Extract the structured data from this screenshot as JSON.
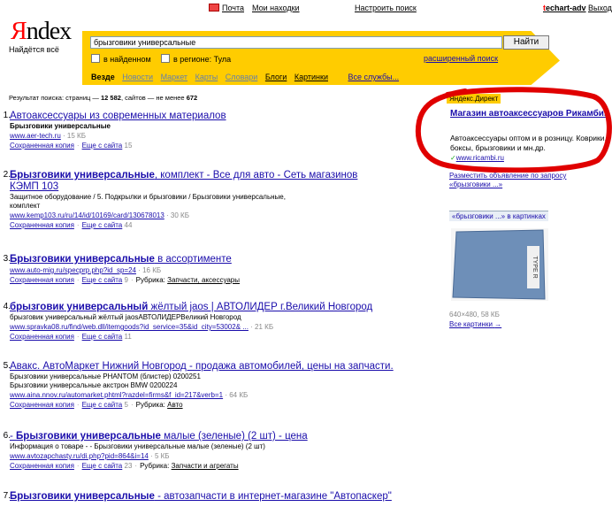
{
  "topnav": {
    "mail": "Почта",
    "finds": "Мои находки",
    "settings": "Настроить поиск",
    "user": "techart-adv",
    "logout": "Выход"
  },
  "header": {
    "logo_ya": "Я",
    "logo_rest": "ndex",
    "tagline": "Найдётся всё"
  },
  "search": {
    "query": "брызговики универсальные",
    "button": "Найти",
    "opt_found": "в найденном",
    "opt_region": "в регионе: Тула",
    "advanced": "расширенный поиск"
  },
  "tabs": {
    "web": "Везде",
    "news": "Новости",
    "market": "Маркет",
    "maps": "Карты",
    "dict": "Словари",
    "blogs": "Блоги",
    "images": "Картинки",
    "all": "Все службы..."
  },
  "stats": {
    "prefix": "Результат поиска: страниц —",
    "pages": "12 582",
    "mid": ", сайтов — не менее",
    "sites": "672"
  },
  "results": [
    {
      "num": "1.",
      "title_pre": "",
      "title_bold": "",
      "title_post": "Автоаксессуары из современных материалов",
      "title2": "",
      "snippet_bold": "Брызговики универсальные",
      "snippet": "",
      "url": "www.aer-tech.ru",
      "size": "15 КБ",
      "cache": "Сохраненная копия",
      "more": "Еще с сайта",
      "more_count": "15",
      "rubric_label": "",
      "rubric": ""
    },
    {
      "num": "2.",
      "title_pre": "",
      "title_bold": "Брызговики универсальные",
      "title_post": ", комплект - Все для авто - Сеть магазинов",
      "title2": "КЭМП 103",
      "snippet_line1": "Защитное оборудование / 5. Подкрылки и брызговики / Брызговики универсальные,",
      "snippet_line2": "комплект",
      "url": "www.kemp103.ru/ru/14/id/10169/card/130678013",
      "size": "30 КБ",
      "cache": "Сохраненная копия",
      "more": "Еще с сайта",
      "more_count": "44"
    },
    {
      "num": "3.",
      "title_bold": "Брызговики универсальные",
      "title_post": " в ассортименте",
      "url": "www.auto-mig.ru/specprp.php?id_sp=24",
      "size": "16 КБ",
      "cache": "Сохраненная копия",
      "more": "Еще с сайта",
      "more_count": "9",
      "rubric_label": "Рубрика:",
      "rubric": "Запчасти, аксессуары"
    },
    {
      "num": "4.",
      "title_bold": "брызговик универсальный",
      "title_post": " жёлтый jaos | АВТОЛИДЕР г.Великий Новгород",
      "snippet_line1": "брызговик универсальный жёлтый jaosАВТОЛИДЕРВеликий Новгород",
      "url": "www.spravka08.ru/find/web.dll/itemgoods?id_service=35&id_city=53002& ...",
      "size": "21 КБ",
      "cache": "Сохраненная копия",
      "more": "Еще с сайта",
      "more_count": "11"
    },
    {
      "num": "5.",
      "title_post": "Авакс. АвтоМаркет Нижний Новгород - продажа автомобилей, цены на запчасти.",
      "snippet_line1": "Брызговики универсальные PHANTOM (блистер) 0200251",
      "snippet_line2": "Брызговики универсальные акстрон BMW 0200224",
      "url": "www.aina.nnov.ru/automarket.phtml?razdel=firms&f_id=217&verb=1",
      "size": "64 КБ",
      "cache": "Сохраненная копия",
      "more": "Еще с сайта",
      "more_count": "5",
      "rubric_label": "Рубрика:",
      "rubric": "Авто"
    },
    {
      "num": "6.",
      "title_pre": "- ",
      "title_bold": "Брызговики универсальные",
      "title_post": " малые (зеленые) (2 шт) - цена",
      "snippet_line1": "Информация о товаре - - Брызговики универсальные малые (зеленые) (2 шт)",
      "url": "www.avtozapchasty.ru/di.php?pid=864&i=14",
      "size": "5 КБ",
      "cache": "Сохраненная копия",
      "more": "Еще с сайта",
      "more_count": "23",
      "rubric_label": "Рубрика:",
      "rubric": "Запчасти и агрегаты"
    },
    {
      "num": "7.",
      "title_bold": "Брызговики универсальные",
      "title_post": " - автозапчасти в интернет-магазине \"Автопаскер\""
    }
  ],
  "direct": {
    "label": "Яндекс.Директ",
    "ad_title": "Магазин автоаксессуаров Рикамби.",
    "ad_text": "Автоаксессуары оптом и в розницу. Коврики, боксы, брызговики и мн.др.",
    "ad_url": "www.ricambi.ru",
    "place_ad": "Разместить объявление по запросу «брызговики ...»"
  },
  "images": {
    "label": "«брызговики ...» в картинках",
    "thumb_text": "TYPE R",
    "size": "640×480, 58 КБ",
    "all": "Все картинки",
    "all_arrow": "→"
  },
  "colors": {
    "yellow": "#ffcc00",
    "link": "#1a0dab",
    "url_green": "#006600",
    "annotation_red": "#e00000"
  }
}
